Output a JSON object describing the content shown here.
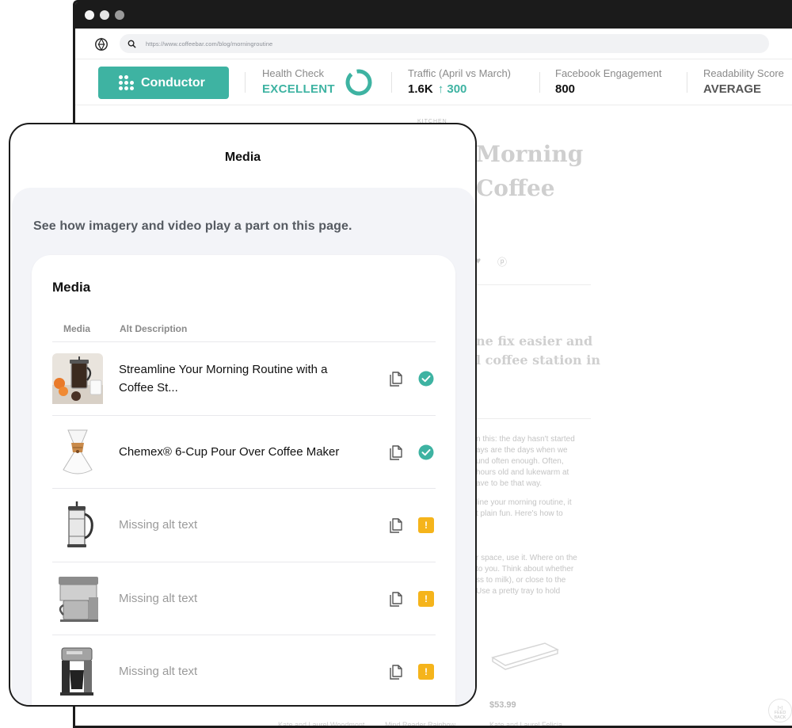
{
  "browser": {
    "url": "https://www.coffeebar.com/blog/morningroutine"
  },
  "toolbar": {
    "app_name": "Conductor",
    "metrics": [
      {
        "label": "Health Check",
        "value": "EXCELLENT"
      },
      {
        "label": "Traffic (April vs March)",
        "value": "1.6K",
        "delta": "300"
      },
      {
        "label": "Facebook Engagement",
        "value": "800"
      },
      {
        "label": "Readability Score",
        "value": "AVERAGE"
      }
    ],
    "colors": {
      "accent": "#3eb3a2",
      "warning": "#f5b41b"
    }
  },
  "blog": {
    "category": "KITCHEN",
    "title_lines": [
      "Morning",
      "Coffee"
    ],
    "subtitle_lines": [
      "ne fix easier and",
      "l coffee station in"
    ],
    "paragraph1": [
      "n this: the day hasn't started",
      "ays are the days when we",
      "und often enough. Often,",
      "hours old and lukewarm at",
      "ave to be that way."
    ],
    "paragraph2": [
      "line your morning routine, it",
      "t plain fun. Here's how to"
    ],
    "paragraph3": [
      "r space, use it. Where on the",
      "to you. Think about whether",
      "ss to milk), or close to the",
      "Use a pretty tray to hold"
    ],
    "price": "$53.99",
    "products": [
      "Kate and Laurel Woodmont",
      "Mind Reader Rainbow",
      "Kate and Laurel Felicia"
    ],
    "feedback_label": "FEED BACK"
  },
  "panel": {
    "title": "Media",
    "intro": "See how imagery and video play a part on this page.",
    "card_title": "Media",
    "columns": {
      "media": "Media",
      "alt": "Alt Description"
    },
    "rows": [
      {
        "image": "coffee-station-photo",
        "alt": "Streamline Your Morning Routine with a Coffee St...",
        "status": "ok"
      },
      {
        "image": "chemex-pour-over",
        "alt": "Chemex® 6-Cup Pour Over Coffee Maker",
        "status": "ok"
      },
      {
        "image": "french-press",
        "alt": "Missing alt text",
        "status": "missing"
      },
      {
        "image": "cold-brew-maker",
        "alt": "Missing alt text",
        "status": "missing"
      },
      {
        "image": "drip-coffee-maker",
        "alt": "Missing alt text",
        "status": "missing"
      }
    ],
    "warning_symbol": "!"
  }
}
